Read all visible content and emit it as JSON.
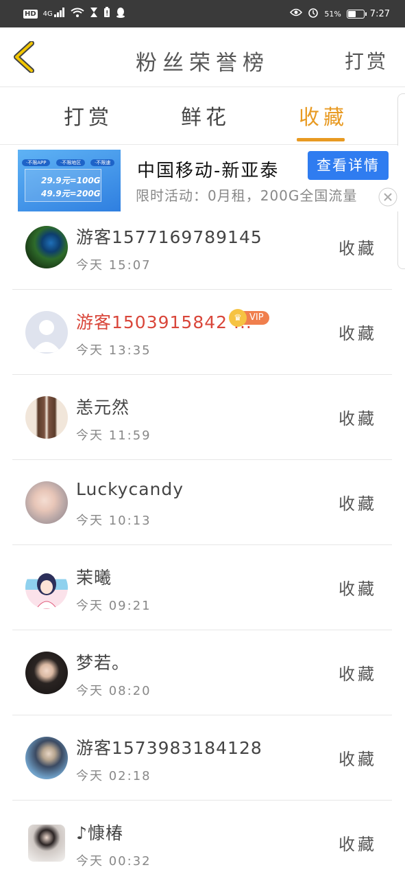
{
  "status_bar": {
    "hd": "HD",
    "network": "4G",
    "battery_percent": "51%",
    "battery_level": 0.51,
    "time": "7:27"
  },
  "header": {
    "title": "粉丝荣誉榜",
    "action": "打赏"
  },
  "tabs": [
    {
      "label": "打赏",
      "active": false
    },
    {
      "label": "鲜花",
      "active": false
    },
    {
      "label": "收藏",
      "active": true
    }
  ],
  "ad": {
    "image_prices": [
      "29.9元=100G",
      "49.9元=200G"
    ],
    "image_tags": [
      "·不限APP",
      "·不限地区",
      "·不限速"
    ],
    "title": "中国移动-新亚泰",
    "description": "限时活动：0月租，200G全国流量",
    "button": "查看详情"
  },
  "list": [
    {
      "name": "游客1577169789145",
      "time": "今天 15:07",
      "action": "收藏",
      "vip": false,
      "avatar": "peacock-avatar"
    },
    {
      "name": "游客1503915842 ...",
      "time": "今天 13:35",
      "action": "收藏",
      "vip": true,
      "vip_label": "VIP",
      "avatar": "default-user-avatar"
    },
    {
      "name": "恙元然",
      "time": "今天 11:59",
      "action": "收藏",
      "vip": false,
      "avatar": "girl-hair-avatar"
    },
    {
      "name": "Luckycandy",
      "time": "今天 10:13",
      "action": "收藏",
      "vip": false,
      "avatar": "girl-photo-avatar"
    },
    {
      "name": "茉曦",
      "time": "今天 09:21",
      "action": "收藏",
      "vip": false,
      "avatar": "anime-girl-avatar"
    },
    {
      "name": "梦若。",
      "time": "今天 08:20",
      "action": "收藏",
      "vip": false,
      "avatar": "woman-portrait-avatar"
    },
    {
      "name": "游客1573983184128",
      "time": "今天 02:18",
      "action": "收藏",
      "vip": false,
      "avatar": "man-costume-avatar"
    },
    {
      "name": "♪慷椿",
      "time": "今天 00:32",
      "action": "收藏",
      "vip": false,
      "avatar": "girl-white-avatar"
    }
  ],
  "colors": {
    "accent": "#e89a22",
    "vip_name": "#d9463a",
    "ad_button": "#2f7cf0",
    "status_bar": "#3a3a3a"
  }
}
